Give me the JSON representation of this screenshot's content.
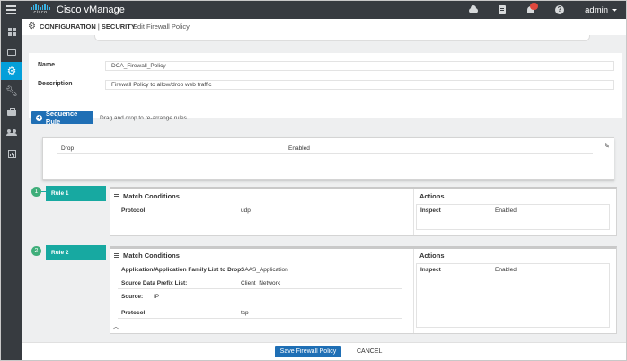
{
  "app": {
    "title": "Cisco vManage",
    "logo_text": "cisco",
    "user": "admin",
    "notification_count": ""
  },
  "topbar": {
    "icons": [
      "hamburger-icon",
      "cloud-icon",
      "tasks-icon",
      "bell-icon",
      "help-icon"
    ]
  },
  "sidebar": {
    "items": [
      {
        "name": "dashboard-icon"
      },
      {
        "name": "monitor-icon"
      },
      {
        "name": "configuration-gear-icon",
        "active": true
      },
      {
        "name": "tools-wrench-icon"
      },
      {
        "name": "maintenance-briefcase-icon"
      },
      {
        "name": "administration-users-icon"
      },
      {
        "name": "analytics-chart-icon"
      }
    ]
  },
  "breadcrumb": {
    "section": "CONFIGURATION",
    "separator": "|",
    "subsection": "SECURITY",
    "page": "Edit Firewall Policy"
  },
  "form": {
    "name_label": "Name",
    "name_value": "DCA_Firewall_Policy",
    "description_label": "Description",
    "description_value": "Firewall Policy to allow/drop web traffic"
  },
  "sequence": {
    "button_label": "Sequence Rule",
    "hint": "Drag and drop to re-arrange rules"
  },
  "default_action": {
    "action": "Drop",
    "status": "Enabled"
  },
  "rules": [
    {
      "number": "1",
      "label": "Rule 1",
      "match_title": "Match Conditions",
      "actions_title": "Actions",
      "conditions": [
        {
          "label": "Protocol:",
          "value": "udp"
        }
      ],
      "action": {
        "label": "Inspect",
        "value": "Enabled"
      }
    },
    {
      "number": "2",
      "label": "Rule 2",
      "match_title": "Match Conditions",
      "actions_title": "Actions",
      "conditions": [
        {
          "label": "Application/Application Family List to Drop:",
          "value": "SAAS_Application"
        },
        {
          "label": "Source Data Prefix List:",
          "value": "Client_Network"
        },
        {
          "label": "Source:",
          "value": "IP"
        },
        {
          "label": "Protocol:",
          "value": "tcp"
        }
      ],
      "action": {
        "label": "Inspect",
        "value": "Enabled"
      }
    }
  ],
  "footer": {
    "save_label": "Save Firewall Policy",
    "cancel_label": "CANCEL"
  },
  "colors": {
    "topbar": "#373b40",
    "accent": "#049fd9",
    "primary_button": "#1f6fb5",
    "rule_tab": "#17a9a1",
    "rule_number": "#3fae7a",
    "badge": "#e2483d"
  }
}
